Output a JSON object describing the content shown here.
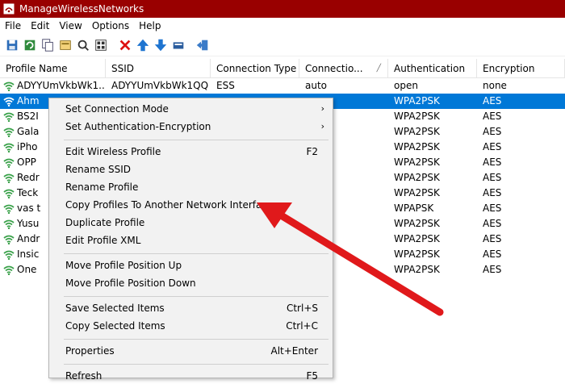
{
  "window": {
    "title": "ManageWirelessNetworks"
  },
  "menubar": [
    "File",
    "Edit",
    "View",
    "Options",
    "Help"
  ],
  "toolbar": [
    "save-icon",
    "refresh-icon",
    "copy-icon",
    "properties-icon",
    "find-icon",
    "html-report-icon",
    "delete-icon",
    "move-up-icon",
    "move-down-icon",
    "edit-icon",
    "exit-icon"
  ],
  "table": {
    "columns": [
      "Profile Name",
      "SSID",
      "Connection Type",
      "Connectio...",
      "Authentication",
      "Encryption"
    ],
    "rows": [
      [
        "ADYYUmVkbWk1...",
        "ADYYUmVkbWk1QQ",
        "ESS",
        "auto",
        "open",
        "none"
      ],
      [
        "Ahm",
        "",
        "",
        "",
        "WPA2PSK",
        "AES"
      ],
      [
        "BS2I",
        "",
        "",
        "",
        "WPA2PSK",
        "AES"
      ],
      [
        "Gala",
        "",
        "",
        "",
        "WPA2PSK",
        "AES"
      ],
      [
        "iPho",
        "",
        "",
        "",
        "WPA2PSK",
        "AES"
      ],
      [
        "OPP",
        "",
        "",
        "",
        "WPA2PSK",
        "AES"
      ],
      [
        "Redr",
        "",
        "",
        "",
        "WPA2PSK",
        "AES"
      ],
      [
        "Teck",
        "",
        "",
        "",
        "WPA2PSK",
        "AES"
      ],
      [
        "vas t",
        "",
        "",
        "",
        "WPAPSK",
        "AES"
      ],
      [
        "Yusu",
        "",
        "",
        "",
        "WPA2PSK",
        "AES"
      ],
      [
        "Andr",
        "",
        "",
        "",
        "WPA2PSK",
        "AES"
      ],
      [
        "Insic",
        "",
        "",
        "",
        "WPA2PSK",
        "AES"
      ],
      [
        "One",
        "",
        "",
        "",
        "WPA2PSK",
        "AES"
      ]
    ],
    "selected_index": 1
  },
  "context_menu": {
    "items": [
      {
        "label": "Set Connection Mode",
        "submenu": true
      },
      {
        "label": "Set Authentication-Encryption",
        "submenu": true
      },
      {
        "separator": true
      },
      {
        "label": "Edit Wireless Profile",
        "shortcut": "F2"
      },
      {
        "label": "Rename SSID"
      },
      {
        "label": "Rename Profile"
      },
      {
        "label": "Copy Profiles To Another Network Interface"
      },
      {
        "label": "Duplicate Profile"
      },
      {
        "label": "Edit Profile XML"
      },
      {
        "separator": true
      },
      {
        "label": "Move Profile Position Up"
      },
      {
        "label": "Move Profile Position Down"
      },
      {
        "separator": true
      },
      {
        "label": "Save Selected Items",
        "shortcut": "Ctrl+S"
      },
      {
        "label": "Copy Selected Items",
        "shortcut": "Ctrl+C"
      },
      {
        "separator": true
      },
      {
        "label": "Properties",
        "shortcut": "Alt+Enter"
      },
      {
        "separator": true
      },
      {
        "label": "Refresh",
        "shortcut": "F5"
      }
    ]
  },
  "colors": {
    "titlebar": "#990000",
    "selection": "#0078d7",
    "annotation_arrow": "#e0191b"
  }
}
